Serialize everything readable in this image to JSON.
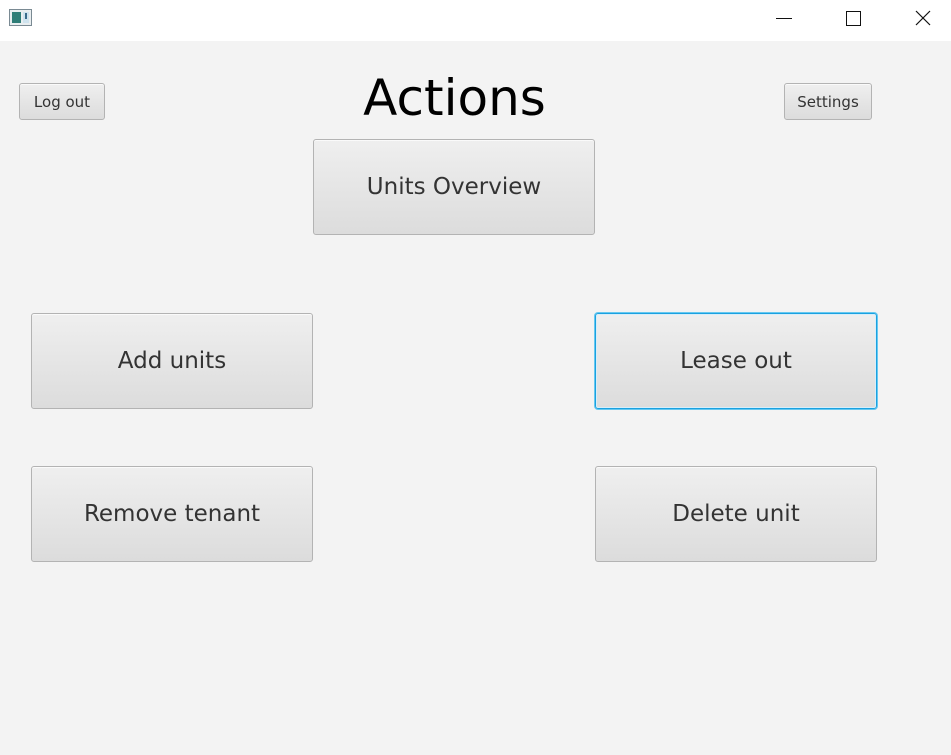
{
  "window": {
    "controls": {
      "minimize": "minimize-icon",
      "maximize": "maximize-icon",
      "close": "close-icon"
    }
  },
  "header": {
    "title": "Actions",
    "logout_label": "Log out",
    "settings_label": "Settings"
  },
  "actions": {
    "units_overview": "Units Overview",
    "add_units": "Add units",
    "lease_out": "Lease out",
    "remove_tenant": "Remove tenant",
    "delete_unit": "Delete unit"
  },
  "colors": {
    "background": "#f3f3f3",
    "button_border": "#b3b3b3",
    "focus_accent": "#1aa1e0"
  }
}
